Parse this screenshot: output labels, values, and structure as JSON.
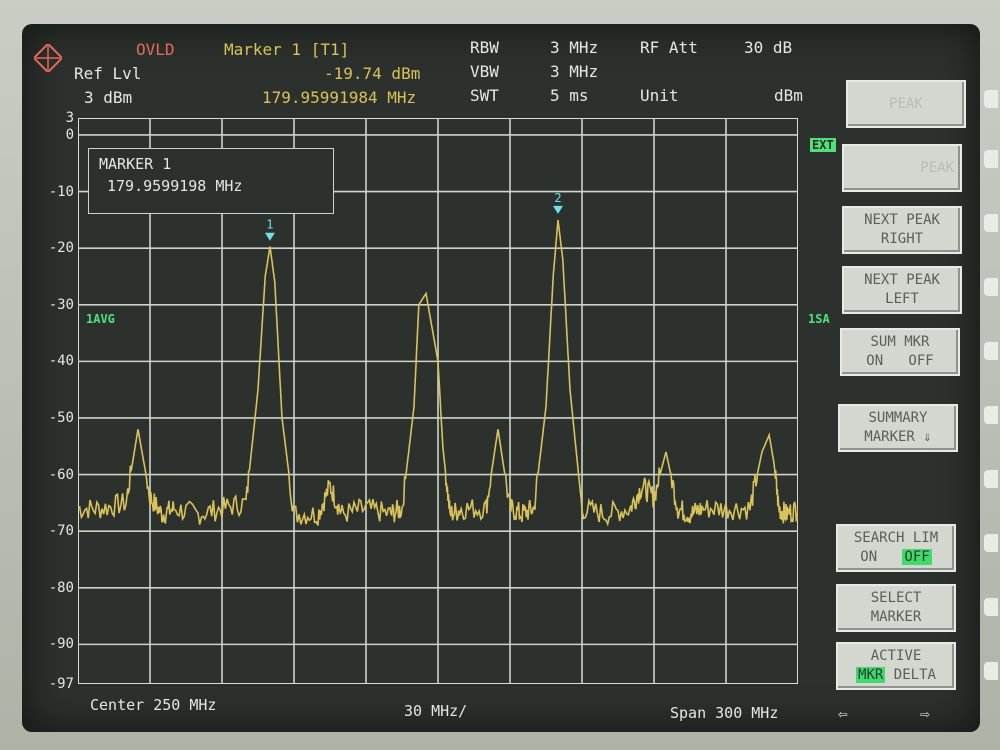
{
  "header": {
    "ovld": "OVLD",
    "marker_title": "Marker 1 [T1]",
    "marker_level": "-19.74 dBm",
    "marker_freq": "179.95991984 MHz",
    "ref_label": "Ref Lvl",
    "ref_value": "3 dBm",
    "rbw_label": "RBW",
    "rbw_value": "3 MHz",
    "vbw_label": "VBW",
    "vbw_value": "3 MHz",
    "swt_label": "SWT",
    "swt_value": "5 ms",
    "rfatt_label": "RF Att",
    "rfatt_value": "30 dB",
    "unit_label": "Unit",
    "unit_value": "dBm"
  },
  "marker_box": {
    "title": "MARKER 1",
    "freq": "179.9599198 MHz"
  },
  "y_ticks": [
    "3",
    "0",
    "-10",
    "-20",
    "-30",
    "-40",
    "-50",
    "-60",
    "-70",
    "-80",
    "-90",
    "-97"
  ],
  "side_tags": {
    "trace": "1AVG",
    "trace2": "1SA",
    "top": "EXT"
  },
  "footer": {
    "center": "Center 250 MHz",
    "div": "30 MHz/",
    "span": "Span 300 MHz"
  },
  "softkeys": {
    "peak": "PEAK",
    "peak2": "PEAK",
    "next_right_1": "NEXT PEAK",
    "next_right_2": "RIGHT",
    "next_left_1": "NEXT PEAK",
    "next_left_2": "LEFT",
    "sum_1": "SUM MKR",
    "sum_on": "ON",
    "sum_off": "OFF",
    "summary_1": "SUMMARY",
    "summary_2": "MARKER ⇓",
    "search_1": "SEARCH LIM",
    "search_on": "ON",
    "search_off": "OFF",
    "select_1": "SELECT",
    "select_2": "MARKER",
    "active_1": "ACTIVE",
    "active_mkr": "MKR",
    "active_delta": "DELTA"
  },
  "markers": [
    {
      "label": "1",
      "freq_mhz": 179.96,
      "level_dbm": -19.74
    },
    {
      "label": "2",
      "freq_mhz": 300,
      "level_dbm": -15
    }
  ],
  "chart_data": {
    "type": "line",
    "xlabel": "",
    "ylabel": "",
    "xlim": [
      100,
      400
    ],
    "ylim": [
      -97,
      3
    ],
    "x": [
      100,
      110,
      120,
      125,
      130,
      135,
      140,
      150,
      160,
      170,
      175,
      178,
      180,
      182,
      185,
      190,
      200,
      205,
      210,
      220,
      230,
      235,
      240,
      242,
      245,
      250,
      252,
      255,
      260,
      270,
      275,
      280,
      285,
      290,
      295,
      298,
      300,
      302,
      305,
      310,
      320,
      330,
      335,
      340,
      345,
      350,
      355,
      360,
      370,
      380,
      385,
      388,
      390,
      392,
      395,
      400
    ],
    "series": [
      {
        "name": "1AVG",
        "values": [
          -66,
          -66,
          -65,
          -52,
          -64,
          -67,
          -66,
          -67,
          -66,
          -65,
          -45,
          -25,
          -19.7,
          -26,
          -50,
          -67,
          -67,
          -62,
          -67,
          -66,
          -67,
          -66,
          -48,
          -30,
          -28,
          -40,
          -55,
          -67,
          -66,
          -66,
          -52,
          -66,
          -67,
          -66,
          -48,
          -25,
          -15,
          -22,
          -45,
          -66,
          -67,
          -66,
          -62,
          -64,
          -56,
          -66,
          -67,
          -66,
          -66,
          -66,
          -56,
          -53,
          -58,
          -66,
          -67,
          -66
        ]
      }
    ]
  }
}
